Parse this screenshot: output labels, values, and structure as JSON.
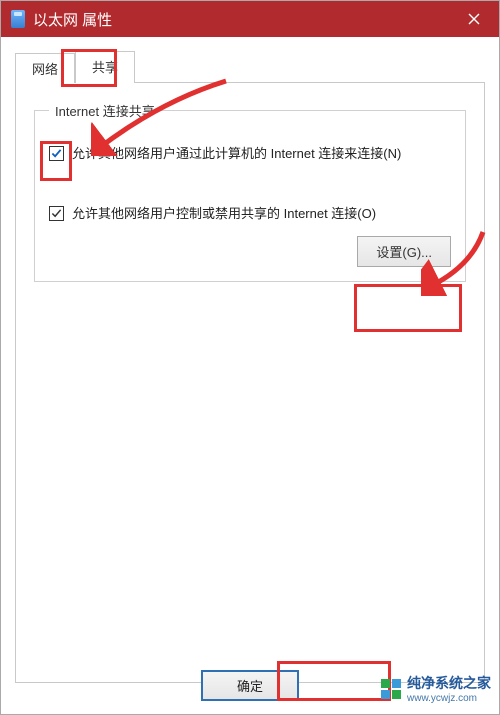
{
  "titlebar": {
    "title": "以太网 属性"
  },
  "tabs": {
    "network": "网络",
    "sharing": "共享",
    "active": "sharing"
  },
  "group": {
    "legend": "Internet 连接共享",
    "option_allow_connect": {
      "checked": true,
      "label": "允许其他网络用户通过此计算机的 Internet 连接来连接(N)"
    },
    "option_allow_control": {
      "checked": true,
      "label": "允许其他网络用户控制或禁用共享的 Internet 连接(O)"
    },
    "settings_button": "设置(G)..."
  },
  "buttons": {
    "ok": "确定"
  },
  "watermark": {
    "text": "纯净系统之家",
    "url": "www.ycwjz.com"
  }
}
